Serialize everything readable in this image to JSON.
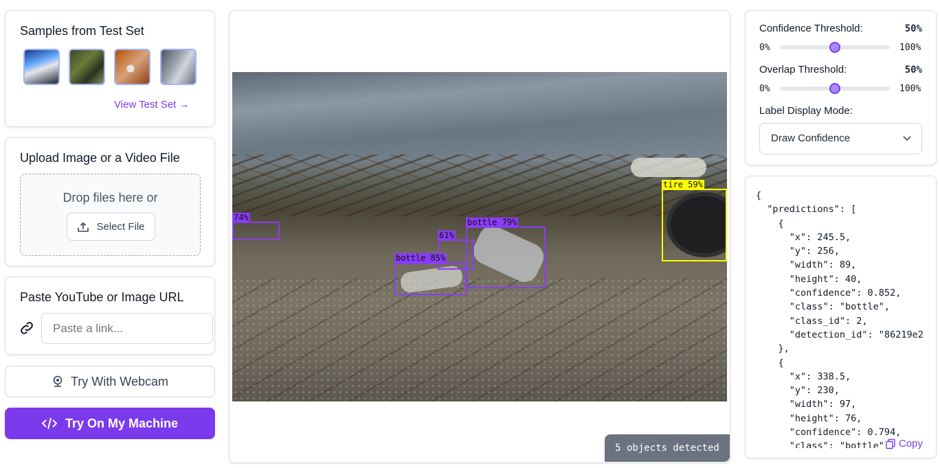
{
  "samples": {
    "title": "Samples from Test Set",
    "view_link": "View Test Set →"
  },
  "upload": {
    "title": "Upload Image or a Video File",
    "drop_text": "Drop files here or",
    "select_label": "Select File"
  },
  "paste": {
    "title": "Paste YouTube or Image URL",
    "placeholder": "Paste a link..."
  },
  "webcam": {
    "label": "Try With Webcam"
  },
  "machine": {
    "label": "Try On My Machine"
  },
  "viewer": {
    "status": "5 objects detected",
    "detections": [
      {
        "label": "74%"
      },
      {
        "label": "61%"
      },
      {
        "label": "bottle 79%"
      },
      {
        "label": "bottle 85%"
      },
      {
        "label": "tire 59%"
      }
    ]
  },
  "settings": {
    "confidence_label": "Confidence Threshold:",
    "confidence_value": "50%",
    "overlap_label": "Overlap Threshold:",
    "overlap_value": "50%",
    "min_label": "0%",
    "max_label": "100%",
    "display_mode_label": "Label Display Mode:",
    "display_mode_value": "Draw Confidence",
    "confidence_level": 0.5,
    "overlap_level": 0.5
  },
  "output": {
    "json_text": "{\n  \"predictions\": [\n    {\n      \"x\": 245.5,\n      \"y\": 256,\n      \"width\": 89,\n      \"height\": 40,\n      \"confidence\": 0.852,\n      \"class\": \"bottle\",\n      \"class_id\": 2,\n      \"detection_id\": \"86219e2\n    },\n    {\n      \"x\": 338.5,\n      \"y\": 230,\n      \"width\": 97,\n      \"height\": 76,\n      \"confidence\": 0.794,\n      \"class\": \"bottle\"",
    "copy_label": "Copy"
  },
  "colors": {
    "accent": "#7c3aed",
    "box_color": "#8b3cf7",
    "tire_color": "#ffff00",
    "status_bg": "#6b7280"
  }
}
